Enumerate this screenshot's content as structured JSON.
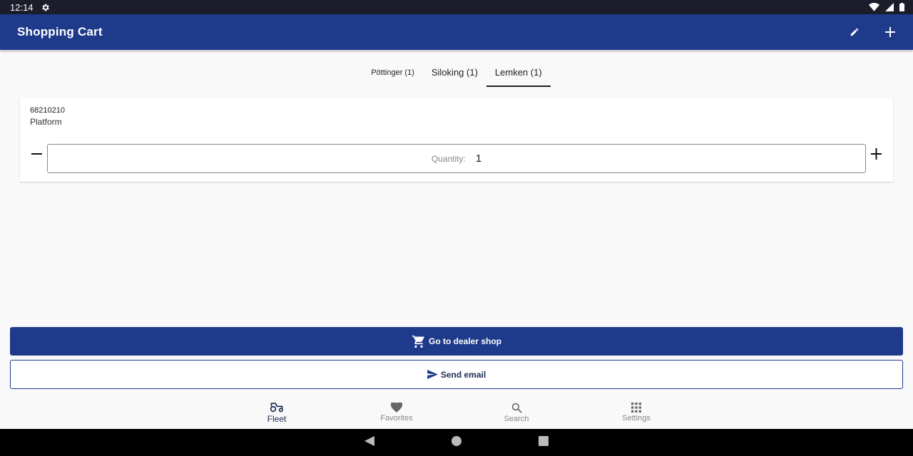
{
  "status_bar": {
    "time": "12:14"
  },
  "app_bar": {
    "title": "Shopping Cart",
    "icons": [
      "pencil-icon",
      "plus-icon"
    ]
  },
  "tabs": [
    {
      "label": "Pöttinger (1)",
      "active": false
    },
    {
      "label": "Siloking (1)",
      "active": false
    },
    {
      "label": "Lemken (1)",
      "active": true
    }
  ],
  "cart_item": {
    "code": "68210210",
    "name": "Platform",
    "quantity_label": "Quantity:",
    "quantity": "1"
  },
  "buttons": {
    "dealer_shop": "Go to dealer shop",
    "send_email": "Send email"
  },
  "bottom_nav": [
    {
      "label": "Fleet",
      "icon": "tractor-icon",
      "active": true
    },
    {
      "label": "Favorites",
      "icon": "heart-icon",
      "active": false
    },
    {
      "label": "Search",
      "icon": "search-icon",
      "active": false
    },
    {
      "label": "Settings",
      "icon": "grid-icon",
      "active": false
    }
  ],
  "colors": {
    "primary": "#1f3a8a",
    "background": "#f9f9f9"
  }
}
